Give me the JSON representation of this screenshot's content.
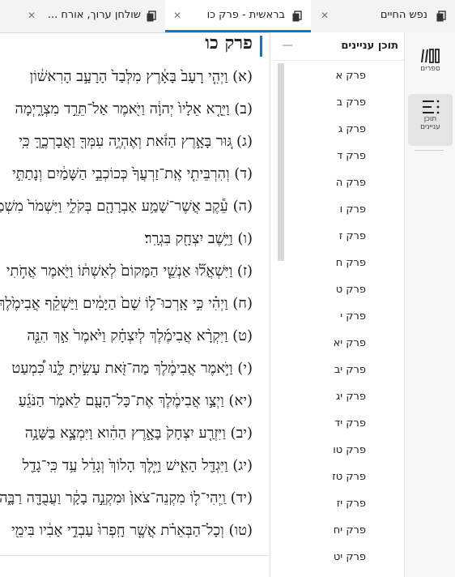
{
  "tabs": [
    {
      "title": "נפש החיים",
      "active": false
    },
    {
      "title": "בראשית - פרק כו",
      "active": true
    },
    {
      "title": "שולחן ערוך, אורח ...",
      "active": false
    }
  ],
  "rail": [
    {
      "label": "ספרים",
      "icon": "library-icon",
      "active": false
    },
    {
      "label": "תוכן עניינים",
      "icon": "toc-icon",
      "active": true
    }
  ],
  "toc": {
    "title": "תוכן עניינים",
    "items": [
      "פרק א",
      "פרק ב",
      "פרק ג",
      "פרק ד",
      "פרק ה",
      "פרק ו",
      "פרק ז",
      "פרק ח",
      "פרק ט",
      "פרק י",
      "פרק יא",
      "פרק יב",
      "פרק יג",
      "פרק יד",
      "פרק טו",
      "פרק טז",
      "פרק יז",
      "פרק יח",
      "פרק יט"
    ]
  },
  "main": {
    "chapter_title": "פרק כו",
    "verses": [
      "(א) וַיְהִ֤י רָעָב֙ בָּאָ֔רֶץ מִלְּבַד֙ הָרָעָ֣ב הָרִאשׁ֔וֹן",
      "(ב) וַיֵּרָ֤א אֵלָיו֙ יְהוָ֔ה וַיֹּ֖אמֶר אַל־תֵּרֵ֣ד מִצְרָ֑יְמָה",
      "(ג) גּ֚וּר בָּאָ֣רֶץ הַזֹּ֔את וְאֶהְיֶ֥ה עִמְּךָ֖ וַאֲבָרְכֶ֑ךָּ כִּֽי",
      "(ד) וְהִרְבֵּיתִ֤י אֶֽת־זַרְעֲךָ֙ כְּכוֹכְבֵ֣י הַשָּׁמַ֔יִם וְנָתַתִּ֣י",
      "(ה) עֵ֕קֶב אֲשֶׁר־שָׁמַ֥ע אַבְרָהָ֖ם בְּקֹלִ֑י וַיִּשְׁמֹר֙ מִשְׁמַרְתִּ֔י",
      "(ו) וַיֵּ֥שֶׁב יִצְחָ֖ק בִּגְרָֽר׃",
      "(ז) וַיִּשְׁאֲל֞וּ אַנְשֵׁ֤י הַמָּקוֹם֙ לְאִשְׁתּ֔וֹ וַיֹּ֖אמֶר אֲחֹ֣תִי",
      "(ח) וַיְהִ֗י כִּ֣י אָֽרְכוּ־ל֥וֹ שָׁם֙ הַיָּמִ֔ים וַיַּשְׁקֵ֗ף אֲבִימֶ֙לֶךְ֙",
      "(ט) וַיִּקְרָ֨א אֲבִימֶ֜לֶךְ לְיִצְחָ֗ק וַיֹּ֙אמֶר֙ אַ֣ךְ הִנֵּ֤ה",
      "(י) וַיֹּ֣אמֶר אֲבִימֶ֔לֶךְ מַה־זֹּ֖את עָשִׂ֣יתָ לָּ֑נוּ כִּ֠מְעַט",
      "(יא) וַיְצַ֣ו אֲבִימֶ֔לֶךְ אֶת־כָּל־הָעָ֖ם לֵאמֹ֑ר הַנֹּגֵ֜עַ",
      "(יב) וַיִּזְרַ֤ע יִצְחָק֙ בָּאָ֣רֶץ הַהִ֔וא וַיִּמְצָ֛א בַּשָּׁנָ֥ה",
      "(יג) וַיִּגְדַּ֖ל הָאִ֑ישׁ וַיֵּ֤לֶךְ הָלוֹךְ֙ וְגָדֵ֔ל עַ֥ד כִּֽי־גָדַ֖ל",
      "(יד) וַֽיְהִי־ל֤וֹ מִקְנֵה־צֹאן֙ וּמִקְנֵ֣ה בָקָ֔ר וַעֲבֻדָּ֖ה רַבָּ֑ה",
      "(טו) וְכָל־הַבְּאֵרֹ֗ת אֲשֶׁ֤ר חָֽפְרוּ֙ עַבְדֵ֣י אָבִ֔יו בִּימֵ֖י"
    ]
  }
}
